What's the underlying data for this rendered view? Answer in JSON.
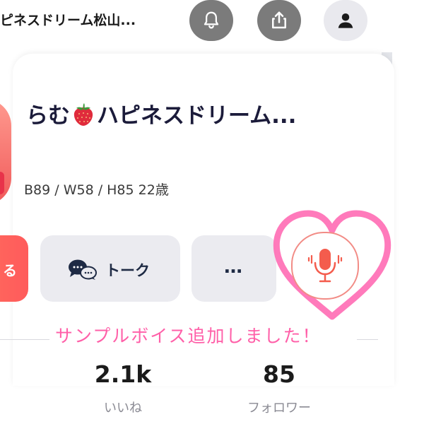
{
  "topbar": {
    "title": "ピネスドリーム松山...",
    "icons": [
      "bell-icon",
      "share-icon",
      "user-icon"
    ]
  },
  "profile": {
    "name_before": "らむ",
    "name_after": "ハピネスドリーム...",
    "name_emoji": "strawberry-icon",
    "measurements": "B89 / W58 / H85  22歳"
  },
  "actions": {
    "primary_label": "る",
    "talk_label": "トーク",
    "more_label": "…",
    "voice_icon": "microphone-icon"
  },
  "annotation": "サンプルボイス追加しました！",
  "stats": {
    "likes_value": "2.1k",
    "likes_label": "いいね",
    "followers_value": "85",
    "followers_label": "フォロワー"
  },
  "colors": {
    "primary": "#ff5b5b",
    "annotation_pink": "#ff5fa8",
    "heart_pink": "#ff6fb5",
    "text_dark": "#1b1b3a"
  }
}
